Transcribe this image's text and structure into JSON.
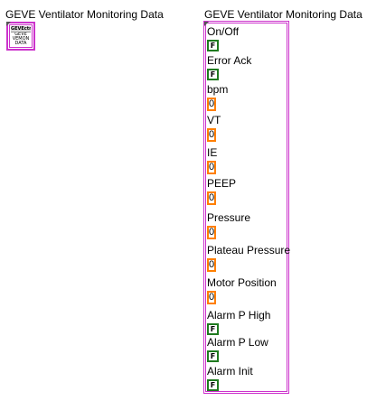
{
  "left_panel": {
    "label": "GEVE Ventilator Monitoring Data",
    "icon": {
      "name": "typedef-icon",
      "header": "GEVEctrl",
      "lines": [
        "GEVE",
        "VEMON",
        "DATA"
      ]
    }
  },
  "cluster": {
    "label": "GEVE Ventilator Monitoring Data",
    "border_color": "#cc33cc",
    "fields": {
      "on_off": {
        "label": "On/Off",
        "value": "F"
      },
      "error_ack": {
        "label": "Error Ack",
        "value": "F"
      },
      "bpm": {
        "label": "bpm",
        "value": "0"
      },
      "vt": {
        "label": "VT",
        "value": "0"
      },
      "ie": {
        "label": "IE",
        "value": "0"
      },
      "peep": {
        "label": "PEEP",
        "value": "0"
      },
      "pressure": {
        "label": "Pressure",
        "value": "0"
      },
      "plateau_pressure": {
        "label": "Plateau Pressure",
        "value": "0"
      },
      "motor_position": {
        "label": "Motor Position",
        "value": "0"
      },
      "alarm_p_high": {
        "label": "Alarm P High",
        "value": "F"
      },
      "alarm_p_low": {
        "label": "Alarm P Low",
        "value": "F"
      },
      "alarm_init": {
        "label": "Alarm Init",
        "value": "F"
      }
    }
  },
  "colors": {
    "cluster_border": "#cc33cc",
    "boolean_border": "#1f7a1f",
    "numeric_border": "#ff7f00"
  }
}
